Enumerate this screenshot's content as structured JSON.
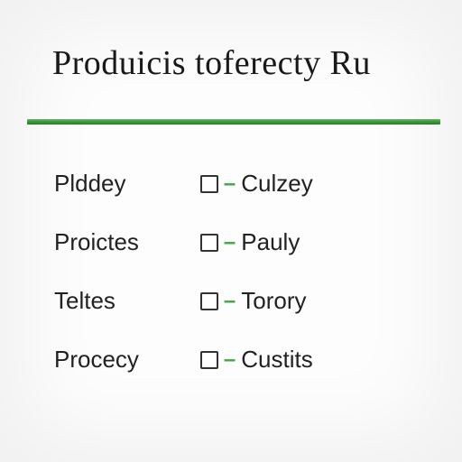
{
  "title": "Produicis toferecty Ru",
  "divider_color": "#3fa83f",
  "columns": {
    "left": [
      {
        "label": "Plddey"
      },
      {
        "label": "Proictes"
      },
      {
        "label": "Teltes"
      },
      {
        "label": "Procecy"
      }
    ],
    "right": [
      {
        "label": "Culzey"
      },
      {
        "label": "Pauly"
      },
      {
        "label": "Torory"
      },
      {
        "label": "Custits"
      }
    ]
  }
}
